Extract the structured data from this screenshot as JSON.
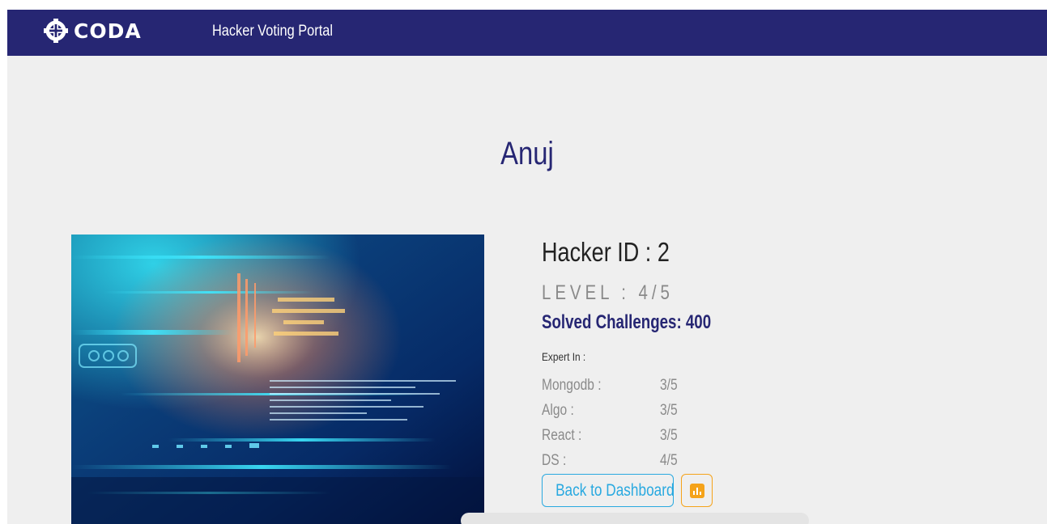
{
  "navbar": {
    "logo_text": "CODA",
    "title": "Hacker Voting Portal",
    "logo_icon": "coda-globe-icon",
    "background_color": "#262673"
  },
  "profile": {
    "name": "Anuj",
    "hacker_id": "Hacker ID : 2",
    "level": "LEVEL : 4/5",
    "solved": "Solved Challenges: 400",
    "expert_label": "Expert In :",
    "skills": [
      {
        "name": "Mongodb :",
        "score": "3/5"
      },
      {
        "name": "Algo :",
        "score": "3/5"
      },
      {
        "name": "React :",
        "score": "3/5"
      },
      {
        "name": "DS :",
        "score": "4/5"
      }
    ],
    "image_description_icon": "code-screen-image"
  },
  "actions": {
    "back_label": "Back to Dashboard",
    "chart_icon": "bar-chart-icon",
    "back_color": "#29a9e0",
    "chart_color": "#f5a31a"
  }
}
